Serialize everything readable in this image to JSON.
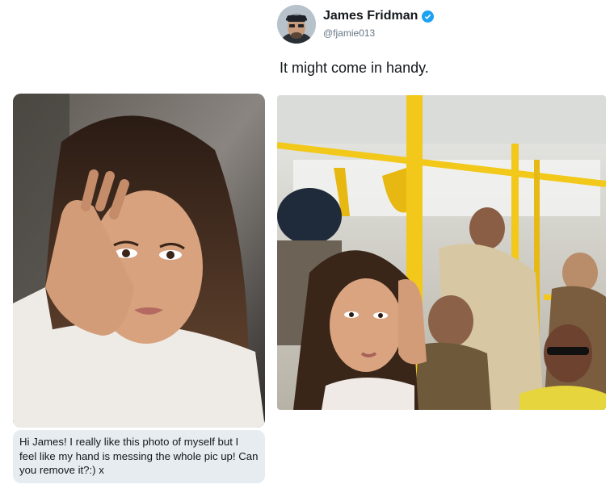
{
  "profile": {
    "display_name": "James Fridman",
    "handle": "@fjamie013",
    "verified_icon": "verified-badge-icon",
    "verified_color": "#1da1f2"
  },
  "tweet": {
    "text": "It might come in handy."
  },
  "message": {
    "text": "Hi James! I really like this photo of myself but I feel like my hand is messing the whole pic up! Can you remove it?:) x"
  },
  "colors": {
    "bubble_bg": "#e6ecf0",
    "pole_yellow": "#f2c81a"
  }
}
